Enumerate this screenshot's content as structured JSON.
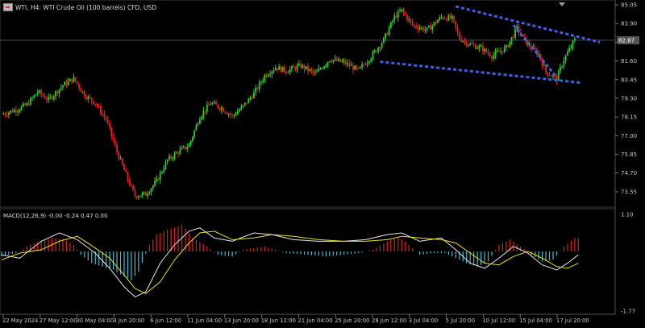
{
  "header": {
    "symbol_text": "WTI, H4:  WTI Crude Oil (100 barrels) CFD, USD"
  },
  "macd_label": "MACD(12,26,9) -0.00 -0.24 0.47 0.00",
  "colors": {
    "background": "#000000",
    "bull": "#2ecc2e",
    "bear": "#e81f1f",
    "trendline": "#3f5fe8",
    "hist_pos": "#d62222",
    "hist_neg": "#4fb7c9",
    "macd_line": "#e8e8e8",
    "signal_line": "#e8e020",
    "price_line": "#7a7a7a",
    "axis_text": "#c8c8c8"
  },
  "chart_data": [
    {
      "type": "candlestick",
      "price_axis_labels": [
        "85.05",
        "83.90",
        "82.75",
        "81.60",
        "80.45",
        "79.30",
        "78.15",
        "77.00",
        "75.85",
        "74.70",
        "73.55"
      ],
      "current_price": "82.87",
      "ylim": [
        72.9,
        85.05
      ],
      "time_axis_labels": [
        "22 May 2024",
        "27 May 12:00",
        "30 May 04:00",
        "3 Jun 20:00",
        "6 Jun 12:00",
        "11 Jun 04:00",
        "13 Jun 20:00",
        "18 Jun 12:00",
        "21 Jun 04:00",
        "25 Jun 20:00",
        "28 Jun 12:00",
        "3 Jul 04:00",
        "5 Jul 20:00",
        "10 Jul 12:00",
        "15 Jul 04:00",
        "17 Jul 20:00"
      ],
      "close_path": [
        [
          0,
          78.3
        ],
        [
          8,
          78.6
        ],
        [
          14,
          78.9
        ],
        [
          20,
          79.7
        ],
        [
          26,
          79.2
        ],
        [
          34,
          80.1
        ],
        [
          40,
          80.5
        ],
        [
          46,
          79.5
        ],
        [
          52,
          79.0
        ],
        [
          58,
          78.0
        ],
        [
          64,
          76.0
        ],
        [
          70,
          74.3
        ],
        [
          74,
          73.3
        ],
        [
          80,
          73.4
        ],
        [
          86,
          74.2
        ],
        [
          92,
          75.5
        ],
        [
          98,
          76.0
        ],
        [
          104,
          76.4
        ],
        [
          110,
          78.2
        ],
        [
          116,
          79.0
        ],
        [
          122,
          78.7
        ],
        [
          128,
          78.2
        ],
        [
          134,
          78.8
        ],
        [
          140,
          79.6
        ],
        [
          146,
          80.7
        ],
        [
          152,
          81.2
        ],
        [
          158,
          81.0
        ],
        [
          166,
          81.3
        ],
        [
          174,
          80.8
        ],
        [
          182,
          81.7
        ],
        [
          190,
          81.5
        ],
        [
          198,
          81.0
        ],
        [
          206,
          82.0
        ],
        [
          212,
          82.9
        ],
        [
          218,
          84.3
        ],
        [
          222,
          84.7
        ],
        [
          228,
          83.8
        ],
        [
          236,
          83.5
        ],
        [
          244,
          84.3
        ],
        [
          250,
          84.2
        ],
        [
          254,
          83.0
        ],
        [
          260,
          82.6
        ],
        [
          266,
          82.4
        ],
        [
          272,
          81.9
        ],
        [
          280,
          82.4
        ],
        [
          286,
          83.6
        ],
        [
          292,
          82.6
        ],
        [
          298,
          82.0
        ],
        [
          302,
          80.9
        ],
        [
          308,
          80.5
        ],
        [
          312,
          81.7
        ],
        [
          318,
          82.9
        ]
      ],
      "trendlines": [
        {
          "from": [
            252,
            84.95
          ],
          "to": [
            332,
            82.75
          ]
        },
        {
          "from": [
            210,
            81.55
          ],
          "to": [
            322,
            80.25
          ]
        },
        {
          "from": [
            284,
            83.8
          ],
          "to": [
            308,
            80.6
          ]
        }
      ]
    },
    {
      "type": "macd",
      "value_axis_labels": [
        "1.10",
        "-1.77"
      ],
      "ylim": [
        -1.77,
        1.1
      ],
      "histogram": [
        [
          0,
          -0.15
        ],
        [
          8,
          -0.05
        ],
        [
          16,
          0.2
        ],
        [
          22,
          0.3
        ],
        [
          28,
          0.4
        ],
        [
          34,
          0.38
        ],
        [
          40,
          0.2
        ],
        [
          44,
          -0.1
        ],
        [
          50,
          -0.35
        ],
        [
          56,
          -0.45
        ],
        [
          62,
          -0.55
        ],
        [
          68,
          -0.75
        ],
        [
          72,
          -0.85
        ],
        [
          76,
          -0.6
        ],
        [
          82,
          0.2
        ],
        [
          86,
          0.5
        ],
        [
          92,
          0.65
        ],
        [
          96,
          0.7
        ],
        [
          100,
          0.8
        ],
        [
          106,
          0.4
        ],
        [
          114,
          0.15
        ],
        [
          120,
          -0.1
        ],
        [
          128,
          -0.15
        ],
        [
          134,
          0.05
        ],
        [
          140,
          0.1
        ],
        [
          146,
          0.15
        ],
        [
          152,
          0.05
        ],
        [
          158,
          -0.05
        ],
        [
          170,
          -0.1
        ],
        [
          180,
          -0.15
        ],
        [
          190,
          -0.1
        ],
        [
          198,
          -0.05
        ],
        [
          206,
          0.05
        ],
        [
          214,
          0.3
        ],
        [
          220,
          0.45
        ],
        [
          226,
          0.2
        ],
        [
          232,
          -0.1
        ],
        [
          240,
          -0.05
        ],
        [
          246,
          -0.05
        ],
        [
          252,
          -0.2
        ],
        [
          258,
          -0.35
        ],
        [
          264,
          -0.45
        ],
        [
          270,
          -0.3
        ],
        [
          276,
          0.2
        ],
        [
          282,
          0.35
        ],
        [
          288,
          0.15
        ],
        [
          294,
          -0.1
        ],
        [
          300,
          -0.3
        ],
        [
          306,
          -0.25
        ],
        [
          312,
          0.15
        ],
        [
          318,
          0.4
        ]
      ],
      "macd_line": [
        [
          0,
          -0.1
        ],
        [
          10,
          -0.2
        ],
        [
          22,
          0.3
        ],
        [
          32,
          0.55
        ],
        [
          42,
          0.35
        ],
        [
          52,
          -0.05
        ],
        [
          60,
          -0.5
        ],
        [
          68,
          -1.05
        ],
        [
          74,
          -1.35
        ],
        [
          80,
          -1.2
        ],
        [
          88,
          -0.35
        ],
        [
          96,
          0.2
        ],
        [
          104,
          0.6
        ],
        [
          110,
          0.7
        ],
        [
          118,
          0.4
        ],
        [
          128,
          0.3
        ],
        [
          140,
          0.55
        ],
        [
          150,
          0.5
        ],
        [
          162,
          0.35
        ],
        [
          176,
          0.3
        ],
        [
          190,
          0.3
        ],
        [
          202,
          0.35
        ],
        [
          214,
          0.5
        ],
        [
          222,
          0.55
        ],
        [
          232,
          0.3
        ],
        [
          244,
          0.4
        ],
        [
          252,
          0.05
        ],
        [
          260,
          -0.35
        ],
        [
          268,
          -0.5
        ],
        [
          276,
          -0.2
        ],
        [
          284,
          0.15
        ],
        [
          292,
          -0.05
        ],
        [
          300,
          -0.4
        ],
        [
          308,
          -0.55
        ],
        [
          314,
          -0.35
        ],
        [
          320,
          -0.1
        ]
      ],
      "signal_line": [
        [
          0,
          -0.25
        ],
        [
          10,
          -0.05
        ],
        [
          22,
          0.05
        ],
        [
          32,
          0.3
        ],
        [
          42,
          0.45
        ],
        [
          52,
          0.1
        ],
        [
          60,
          -0.2
        ],
        [
          68,
          -0.7
        ],
        [
          74,
          -1.1
        ],
        [
          80,
          -1.25
        ],
        [
          88,
          -0.9
        ],
        [
          96,
          -0.25
        ],
        [
          104,
          0.25
        ],
        [
          110,
          0.55
        ],
        [
          118,
          0.6
        ],
        [
          128,
          0.35
        ],
        [
          140,
          0.4
        ],
        [
          150,
          0.5
        ],
        [
          162,
          0.45
        ],
        [
          176,
          0.35
        ],
        [
          190,
          0.3
        ],
        [
          202,
          0.3
        ],
        [
          214,
          0.35
        ],
        [
          222,
          0.45
        ],
        [
          232,
          0.4
        ],
        [
          244,
          0.35
        ],
        [
          252,
          0.25
        ],
        [
          260,
          -0.05
        ],
        [
          268,
          -0.35
        ],
        [
          276,
          -0.4
        ],
        [
          284,
          -0.15
        ],
        [
          292,
          0.0
        ],
        [
          300,
          -0.2
        ],
        [
          308,
          -0.45
        ],
        [
          314,
          -0.5
        ],
        [
          320,
          -0.35
        ]
      ]
    }
  ]
}
